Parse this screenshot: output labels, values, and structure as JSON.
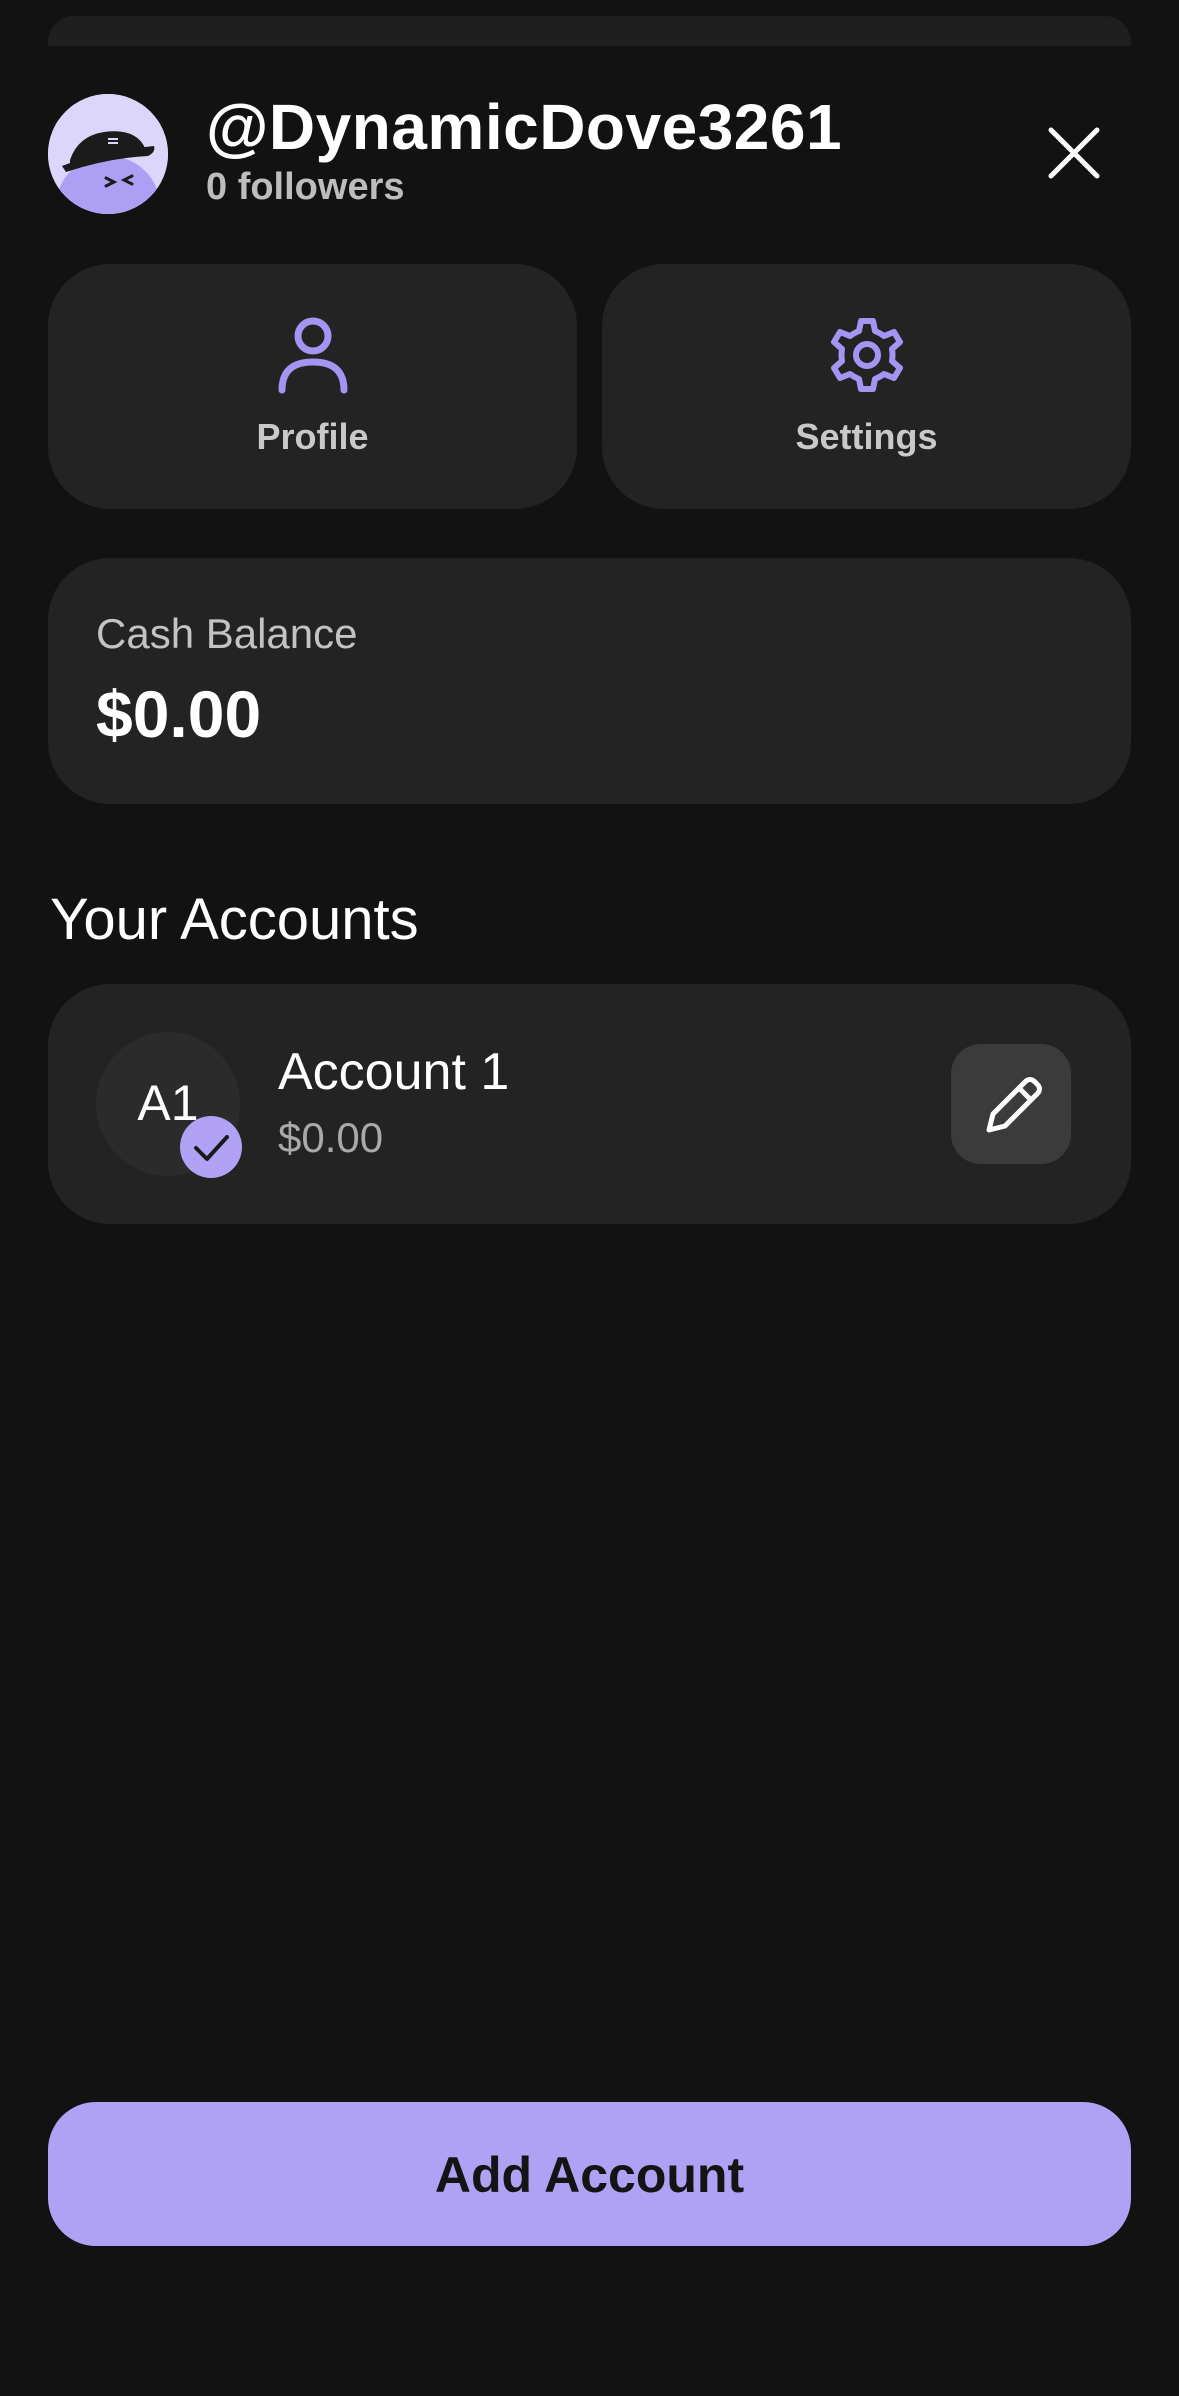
{
  "header": {
    "username": "@DynamicDove3261",
    "followers": "0 followers"
  },
  "tiles": {
    "profile_label": "Profile",
    "settings_label": "Settings"
  },
  "balance": {
    "label": "Cash Balance",
    "value": "$0.00"
  },
  "accounts": {
    "title": "Your Accounts",
    "items": [
      {
        "initials": "A1",
        "name": "Account 1",
        "balance": "$0.00",
        "selected": true
      }
    ]
  },
  "footer": {
    "add_account_label": "Add Account"
  },
  "colors": {
    "background": "#121212",
    "card": "#232323",
    "accent": "#afa2f5",
    "accent_icon": "#a594f2"
  },
  "icons": {
    "avatar": "dove-avatar-icon",
    "close": "close-icon",
    "profile": "person-icon",
    "settings": "gear-icon",
    "selected": "check-icon",
    "edit": "pencil-icon"
  }
}
